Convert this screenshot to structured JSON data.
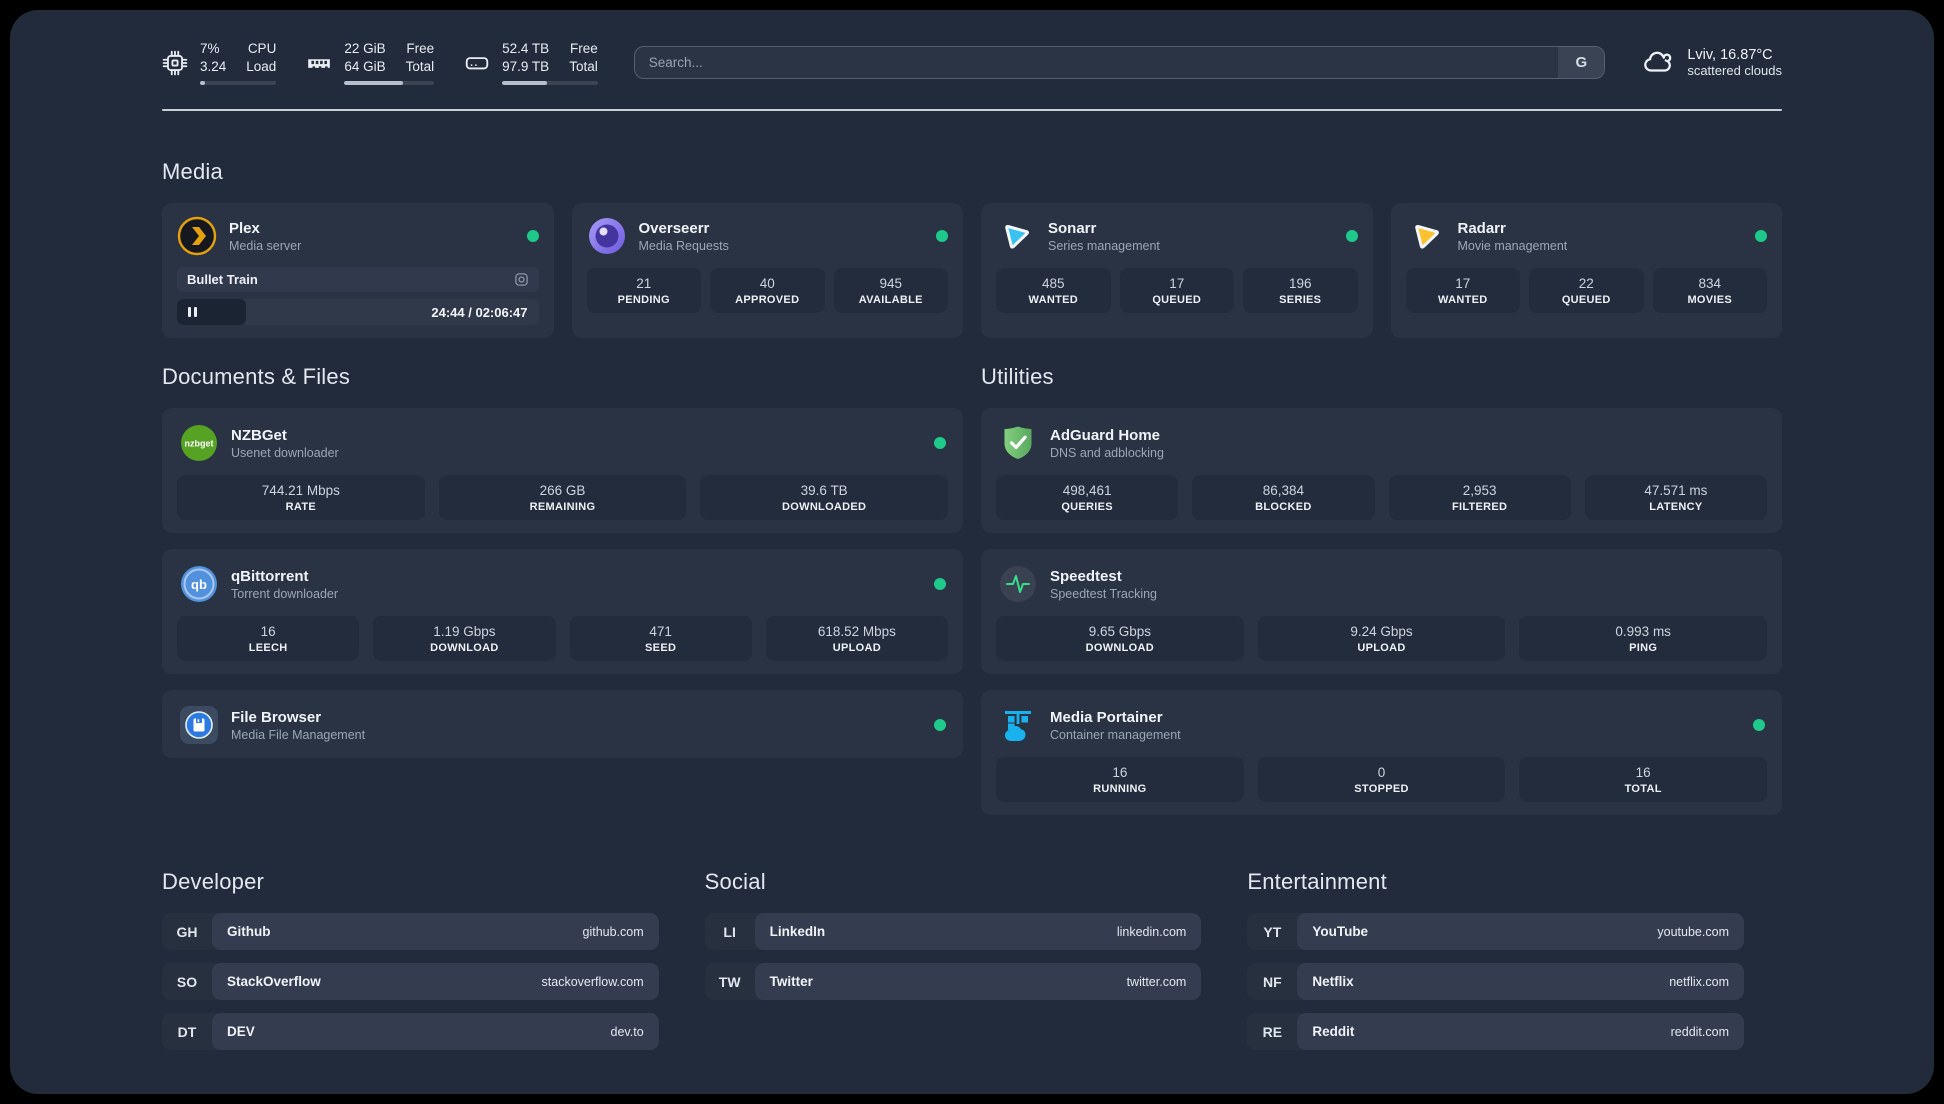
{
  "colors": {
    "background": "#222b3c",
    "card": "#2a3344",
    "tile": "#232c3c",
    "status_online": "#1fc98c",
    "accent_plex": "#e5a00d"
  },
  "header": {
    "resources": [
      {
        "icon": "cpu-icon",
        "value_top": "7%",
        "value_bottom": "3.24",
        "label_top": "CPU",
        "label_bottom": "Load",
        "progress": 7
      },
      {
        "icon": "ram-icon",
        "value_top": "22 GiB",
        "value_bottom": "64 GiB",
        "label_top": "Free",
        "label_bottom": "Total",
        "progress": 65
      },
      {
        "icon": "disk-icon",
        "value_top": "52.4 TB",
        "value_bottom": "97.9 TB",
        "label_top": "Free",
        "label_bottom": "Total",
        "progress": 47
      }
    ],
    "search": {
      "placeholder": "Search...",
      "engine_label": "G"
    },
    "weather": {
      "icon": "cloud-icon",
      "location_temp": "Lviv, 16.87°C",
      "condition": "scattered clouds"
    }
  },
  "media": {
    "title": "Media",
    "cards": [
      {
        "icon": "plex-icon",
        "name": "Plex",
        "subtitle": "Media server",
        "online": true,
        "now_playing": {
          "title": "Bullet Train",
          "time": "24:44 / 02:06:47",
          "progress": 19,
          "state": "paused"
        }
      },
      {
        "icon": "overseerr-icon",
        "name": "Overseerr",
        "subtitle": "Media Requests",
        "online": true,
        "stats": [
          {
            "value": "21",
            "label": "PENDING"
          },
          {
            "value": "40",
            "label": "APPROVED"
          },
          {
            "value": "945",
            "label": "AVAILABLE"
          }
        ]
      },
      {
        "icon": "sonarr-icon",
        "name": "Sonarr",
        "subtitle": "Series management",
        "online": true,
        "stats": [
          {
            "value": "485",
            "label": "WANTED"
          },
          {
            "value": "17",
            "label": "QUEUED"
          },
          {
            "value": "196",
            "label": "SERIES"
          }
        ]
      },
      {
        "icon": "radarr-icon",
        "name": "Radarr",
        "subtitle": "Movie management",
        "online": true,
        "stats": [
          {
            "value": "17",
            "label": "WANTED"
          },
          {
            "value": "22",
            "label": "QUEUED"
          },
          {
            "value": "834",
            "label": "MOVIES"
          }
        ]
      }
    ]
  },
  "documents": {
    "title": "Documents & Files",
    "cards": [
      {
        "icon": "nzbget-icon",
        "icon_text": "nzbget",
        "name": "NZBGet",
        "subtitle": "Usenet downloader",
        "online": true,
        "stats": [
          {
            "value": "744.21 Mbps",
            "label": "RATE"
          },
          {
            "value": "266 GB",
            "label": "REMAINING"
          },
          {
            "value": "39.6 TB",
            "label": "DOWNLOADED"
          }
        ]
      },
      {
        "icon": "qbittorrent-icon",
        "icon_text": "qb",
        "name": "qBittorrent",
        "subtitle": "Torrent downloader",
        "online": true,
        "stats": [
          {
            "value": "16",
            "label": "LEECH"
          },
          {
            "value": "1.19 Gbps",
            "label": "DOWNLOAD"
          },
          {
            "value": "471",
            "label": "SEED"
          },
          {
            "value": "618.52 Mbps",
            "label": "UPLOAD"
          }
        ]
      },
      {
        "icon": "filebrowser-icon",
        "name": "File Browser",
        "subtitle": "Media File Management",
        "online": true,
        "stats": []
      }
    ]
  },
  "utilities": {
    "title": "Utilities",
    "cards": [
      {
        "icon": "adguard-icon",
        "name": "AdGuard Home",
        "subtitle": "DNS and adblocking",
        "online": false,
        "stats": [
          {
            "value": "498,461",
            "label": "QUERIES"
          },
          {
            "value": "86,384",
            "label": "BLOCKED"
          },
          {
            "value": "2,953",
            "label": "FILTERED"
          },
          {
            "value": "47.571 ms",
            "label": "LATENCY"
          }
        ]
      },
      {
        "icon": "speedtest-icon",
        "name": "Speedtest",
        "subtitle": "Speedtest Tracking",
        "online": false,
        "stats": [
          {
            "value": "9.65 Gbps",
            "label": "DOWNLOAD"
          },
          {
            "value": "9.24 Gbps",
            "label": "UPLOAD"
          },
          {
            "value": "0.993 ms",
            "label": "PING"
          }
        ]
      },
      {
        "icon": "portainer-icon",
        "name": "Media Portainer",
        "subtitle": "Container management",
        "online": true,
        "stats": [
          {
            "value": "16",
            "label": "RUNNING"
          },
          {
            "value": "0",
            "label": "STOPPED"
          },
          {
            "value": "16",
            "label": "TOTAL"
          }
        ]
      }
    ]
  },
  "links": {
    "developer": {
      "title": "Developer",
      "items": [
        {
          "abbr": "GH",
          "name": "Github",
          "url": "github.com"
        },
        {
          "abbr": "SO",
          "name": "StackOverflow",
          "url": "stackoverflow.com"
        },
        {
          "abbr": "DT",
          "name": "DEV",
          "url": "dev.to"
        }
      ]
    },
    "social": {
      "title": "Social",
      "items": [
        {
          "abbr": "LI",
          "name": "LinkedIn",
          "url": "linkedin.com"
        },
        {
          "abbr": "TW",
          "name": "Twitter",
          "url": "twitter.com"
        }
      ]
    },
    "entertainment": {
      "title": "Entertainment",
      "items": [
        {
          "abbr": "YT",
          "name": "YouTube",
          "url": "youtube.com"
        },
        {
          "abbr": "NF",
          "name": "Netflix",
          "url": "netflix.com"
        },
        {
          "abbr": "RE",
          "name": "Reddit",
          "url": "reddit.com"
        }
      ]
    }
  }
}
